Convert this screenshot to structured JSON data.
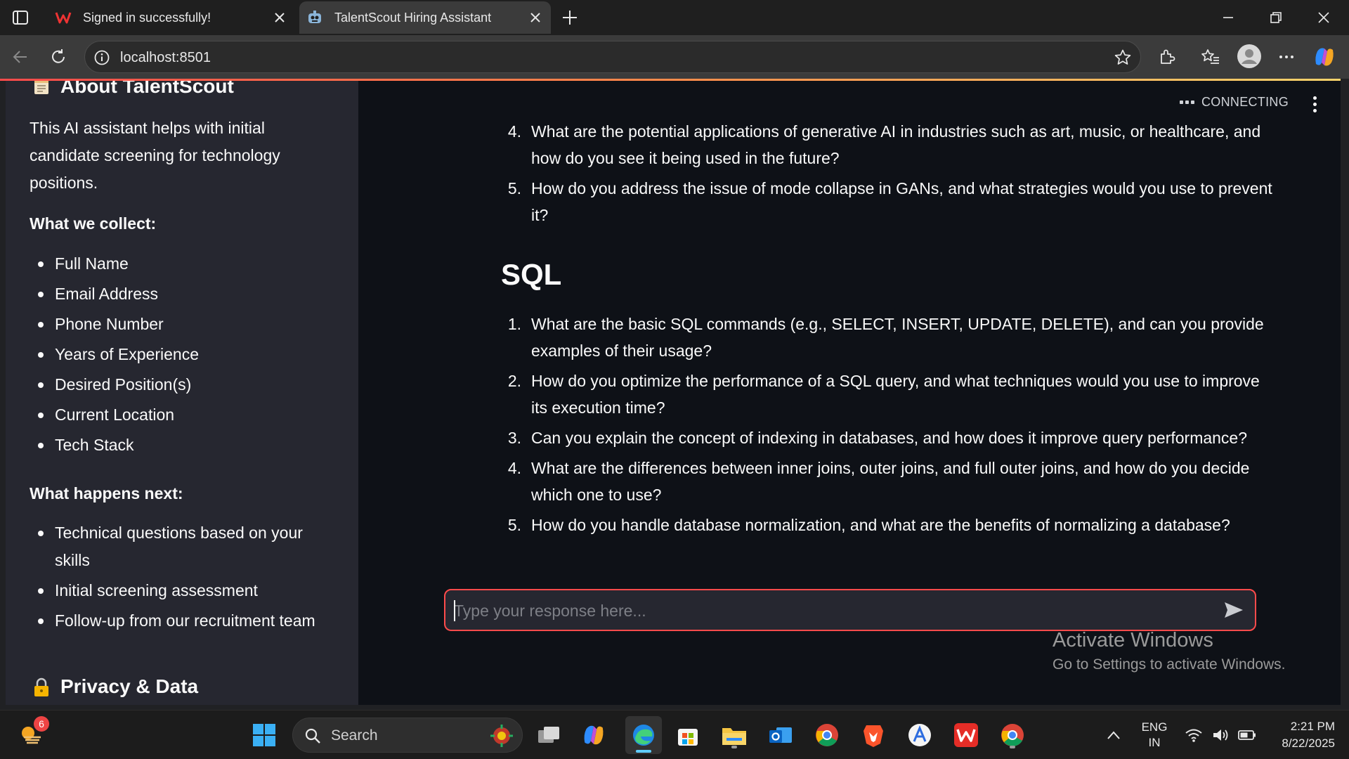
{
  "browser": {
    "tabs": [
      {
        "title": "Signed in successfully!",
        "favicon": "wps-logo-icon",
        "active": false
      },
      {
        "title": "TalentScout Hiring Assistant",
        "favicon": "robot-icon",
        "active": true
      }
    ],
    "url": "localhost:8501"
  },
  "sidebar": {
    "about_title": "About TalentScout",
    "about_text": "This AI assistant helps with initial candidate screening for technology positions.",
    "collect_heading": "What we collect:",
    "collect_items": [
      "Full Name",
      "Email Address",
      "Phone Number",
      "Years of Experience",
      "Desired Position(s)",
      "Current Location",
      "Tech Stack"
    ],
    "next_heading": "What happens next:",
    "next_items": [
      "Technical questions based on your skills",
      "Initial screening assessment",
      "Follow-up from our recruitment team"
    ],
    "privacy_title": "Privacy & Data"
  },
  "status": {
    "label": "CONNECTING"
  },
  "chat": {
    "prev_questions": [
      {
        "num": "4.",
        "text": "What are the potential applications of generative AI in industries such as art, music, or healthcare, and how do you see it being used in the future?"
      },
      {
        "num": "5.",
        "text": "How do you address the issue of mode collapse in GANs, and what strategies would you use to prevent it?"
      }
    ],
    "section_title": "SQL",
    "sql_questions": [
      {
        "num": "1.",
        "text": "What are the basic SQL commands (e.g., SELECT, INSERT, UPDATE, DELETE), and can you provide examples of their usage?"
      },
      {
        "num": "2.",
        "text": "How do you optimize the performance of a SQL query, and what techniques would you use to improve its execution time?"
      },
      {
        "num": "3.",
        "text": "Can you explain the concept of indexing in databases, and how does it improve query performance?"
      },
      {
        "num": "4.",
        "text": "What are the differences between inner joins, outer joins, and full outer joins, and how do you decide which one to use?"
      },
      {
        "num": "5.",
        "text": "How do you handle database normalization, and what are the benefits of normalizing a database?"
      }
    ],
    "input_placeholder": "Type your response here..."
  },
  "watermark": {
    "title": "Activate Windows",
    "subtitle": "Go to Settings to activate Windows."
  },
  "taskbar": {
    "weather_badge": "6",
    "search_label": "Search",
    "lang_top": "ENG",
    "lang_bottom": "IN",
    "time": "2:21 PM",
    "date": "8/22/2025"
  },
  "colors": {
    "accent": "#ff4b4b",
    "sidebar_bg": "#262730",
    "main_bg": "#0e1117"
  }
}
